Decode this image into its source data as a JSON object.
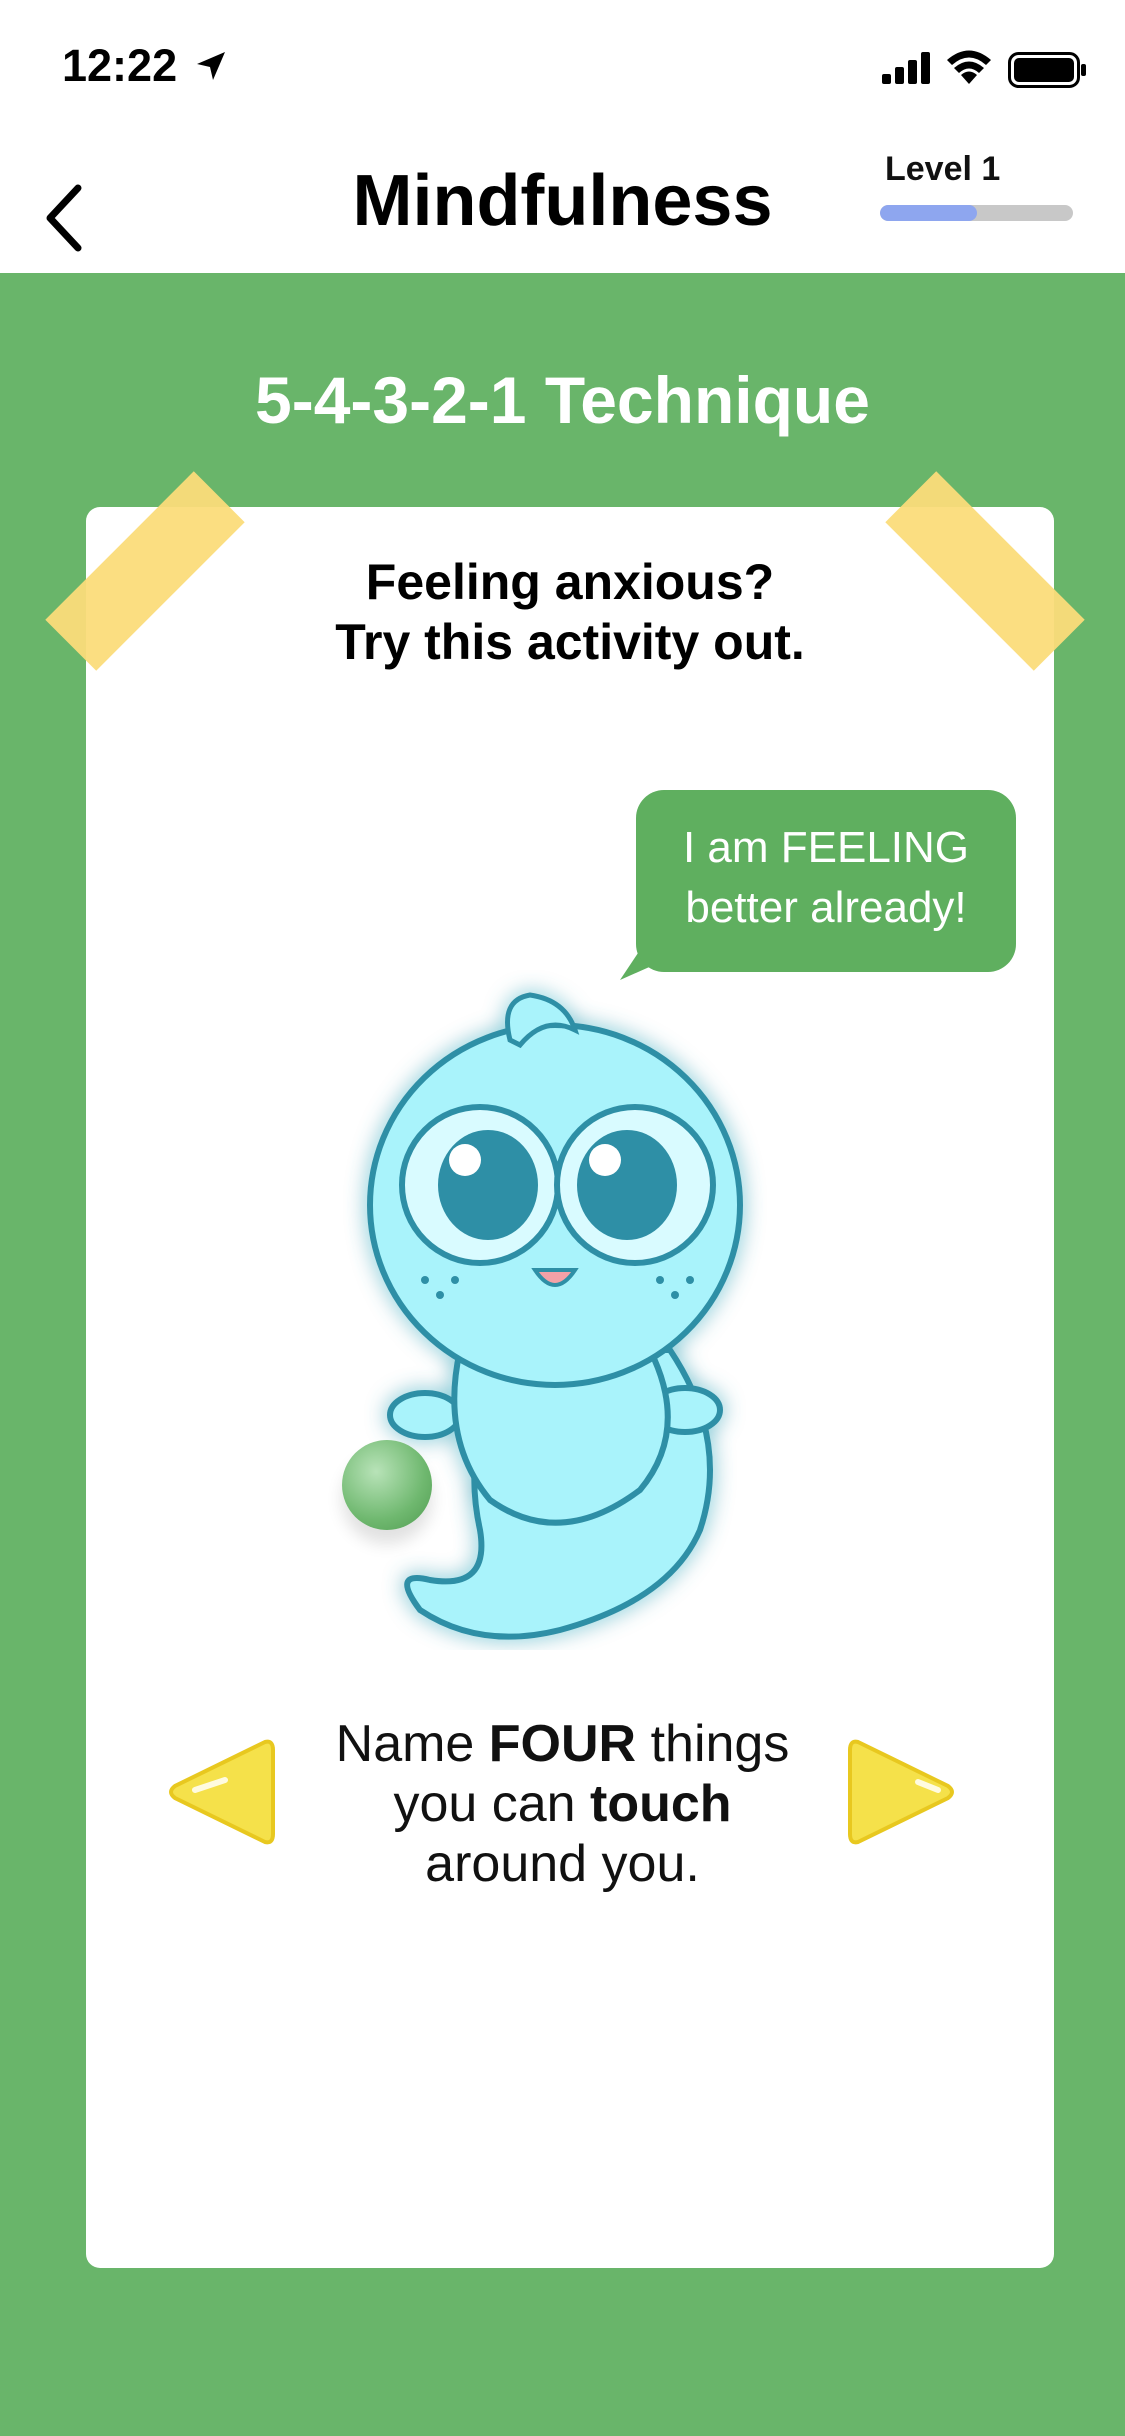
{
  "status_bar": {
    "time": "12:22",
    "icons": [
      "location-arrow-icon",
      "signal-icon",
      "wifi-icon",
      "battery-icon"
    ]
  },
  "nav": {
    "title": "Mindfulness",
    "back_icon": "chevron-left-icon",
    "level": {
      "label": "Level 1",
      "progress": 0.5
    }
  },
  "section": {
    "title": "5-4-3-2-1 Technique"
  },
  "card": {
    "heading_line1": "Feeling anxious?",
    "heading_line2": "Try this activity out.",
    "bubble_line1": "I am FEELING",
    "bubble_line2": "better already!",
    "instruction": {
      "part1": "Name ",
      "bold1": "FOUR",
      "part2": " things",
      "part3": "you can ",
      "bold2": "touch",
      "part4": "around you."
    },
    "prev_icon": "triangle-left-icon",
    "next_icon": "triangle-right-icon"
  },
  "colors": {
    "background": "#69b56a",
    "card": "#ffffff",
    "bubble": "#5faf5f",
    "tape": "#fbdc7a",
    "level_fill": "#8ea6ef",
    "arrow": "#f5e14a",
    "mascot": "#a9f3fb"
  }
}
